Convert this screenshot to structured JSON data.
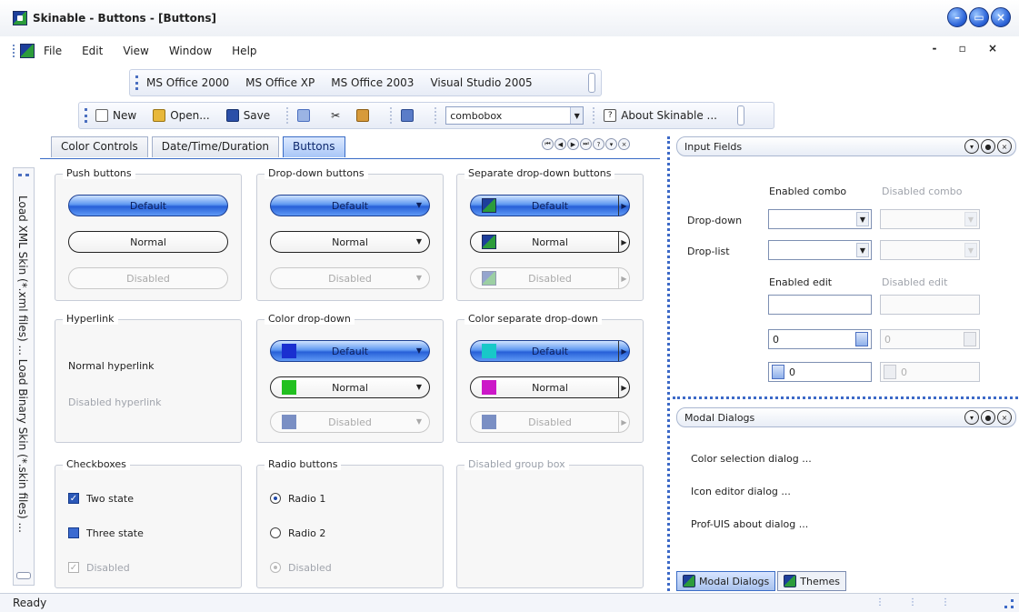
{
  "window": {
    "title": "Skinable - Buttons - [Buttons]"
  },
  "menu": {
    "items": [
      "File",
      "Edit",
      "View",
      "Window",
      "Help"
    ],
    "mdi_controls": "- ▫ ×"
  },
  "toolbar_styles": {
    "items": [
      "MS Office 2000",
      "MS Office XP",
      "MS Office 2003",
      "Visual Studio 2005"
    ]
  },
  "toolbar_main": {
    "new_label": "New",
    "open_label": "Open...",
    "save_label": "Save",
    "combo_value": "combobox",
    "about_label": "About Skinable ..."
  },
  "tabs": [
    "Color Controls",
    "Date/Time/Duration",
    "Buttons"
  ],
  "left_bar": {
    "text": "Load XML Skin (*.xml files) ...   Load Binary Skin (*.skin files) ..."
  },
  "groups": {
    "push": {
      "title": "Push buttons",
      "b1": "Default",
      "b2": "Normal",
      "b3": "Disabled"
    },
    "dropdown": {
      "title": "Drop-down buttons",
      "b1": "Default",
      "b2": "Normal",
      "b3": "Disabled"
    },
    "sepdrop": {
      "title": "Separate drop-down buttons",
      "b1": "Default",
      "b2": "Normal",
      "b3": "Disabled"
    },
    "hyperlink": {
      "title": "Hyperlink",
      "normal": "Normal hyperlink",
      "disabled": "Disabled hyperlink"
    },
    "colordrop": {
      "title": "Color drop-down",
      "b1": "Default",
      "b2": "Normal",
      "b3": "Disabled"
    },
    "colorsep": {
      "title": "Color separate drop-down",
      "b1": "Default",
      "b2": "Normal",
      "b3": "Disabled"
    },
    "checkboxes": {
      "title": "Checkboxes",
      "c1": "Two state",
      "c2": "Three state",
      "c3": "Disabled"
    },
    "radios": {
      "title": "Radio buttons",
      "r1": "Radio 1",
      "r2": "Radio 2",
      "r3": "Disabled"
    },
    "disabled_group": {
      "title": "Disabled group box"
    }
  },
  "swatches": {
    "colordrop": [
      "#1a2fd0",
      "#22c020",
      "#7a8fc4"
    ],
    "colorsep": [
      "#18c8c8",
      "#cc18c8",
      "#7a8fc4"
    ]
  },
  "input_panel": {
    "title": "Input Fields",
    "enabled_combo": "Enabled combo",
    "disabled_combo": "Disabled combo",
    "drop_down": "Drop-down",
    "drop_list": "Drop-list",
    "enabled_edit": "Enabled edit",
    "disabled_edit": "Disabled edit",
    "spin_value": "0",
    "spin_value_dis": "0",
    "spin2_value": "0",
    "spin2_value_dis": "0"
  },
  "modal_panel": {
    "title": "Modal Dialogs",
    "items": [
      "Color selection dialog ...",
      "Icon editor dialog ...",
      "Prof-UIS about dialog ..."
    ]
  },
  "bottom_tabs": [
    "Modal Dialogs",
    "Themes"
  ],
  "status": {
    "text": "Ready"
  }
}
